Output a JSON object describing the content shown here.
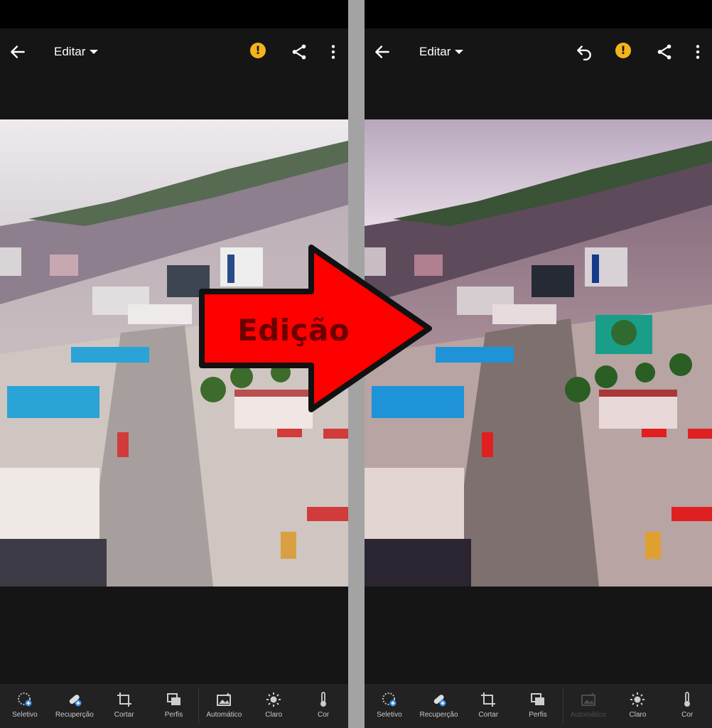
{
  "left": {
    "header": {
      "title": "Editar"
    },
    "toolbar": {
      "tools": [
        {
          "label": "Seletivo",
          "icon": "selective-icon"
        },
        {
          "label": "Recuperção",
          "icon": "healing-brush-icon"
        },
        {
          "label": "Cortar",
          "icon": "crop-icon"
        },
        {
          "label": "Perfis",
          "icon": "profiles-icon"
        },
        {
          "label": "Automático",
          "icon": "auto-icon"
        },
        {
          "label": "Claro",
          "icon": "light-icon"
        },
        {
          "label": "Cor",
          "icon": "color-thermometer-icon"
        }
      ]
    }
  },
  "right": {
    "header": {
      "title": "Editar"
    },
    "toolbar": {
      "tools": [
        {
          "label": "Seletivo",
          "icon": "selective-icon"
        },
        {
          "label": "Recuperção",
          "icon": "healing-brush-icon"
        },
        {
          "label": "Cortar",
          "icon": "crop-icon"
        },
        {
          "label": "Perfis",
          "icon": "profiles-icon"
        },
        {
          "label": "Automático",
          "icon": "auto-icon",
          "disabled": true
        },
        {
          "label": "Claro",
          "icon": "light-icon"
        },
        {
          "label": "Cor",
          "icon": "color-thermometer-icon"
        }
      ]
    }
  },
  "overlay": {
    "arrow_label": "Edição",
    "arrow_color": "#ff0000"
  },
  "colors": {
    "warning": "#f3b31b",
    "app_bg": "#151515",
    "toolbar_bg": "#222222"
  }
}
